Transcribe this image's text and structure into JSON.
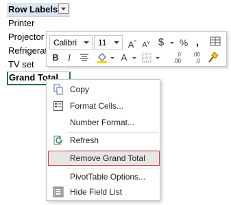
{
  "sheet": {
    "header": "Row Labels",
    "rows": [
      "Printer",
      "Projector",
      "Refrigerator",
      "TV set"
    ],
    "grand_total": "Grand Total"
  },
  "minibar": {
    "font_name": "Calibri",
    "font_size": "11",
    "grow_label": "A",
    "shrink_label": "A",
    "currency_label": "$",
    "percent_label": "%",
    "comma_label": " , ",
    "bold_label": "B",
    "italic_label": "I",
    "font_color_label": "A",
    "increase_decimal_label": "←.0 .00",
    "decrease_decimal_label": ".00 →.0"
  },
  "menu": {
    "items": [
      {
        "label": "Copy"
      },
      {
        "label": "Format Cells..."
      },
      {
        "label": "Number Format..."
      },
      {
        "label": "Refresh"
      },
      {
        "label": "Remove Grand Total"
      },
      {
        "label": "PivotTable Options..."
      },
      {
        "label": "Hide Field List"
      }
    ]
  },
  "colors": {
    "accent": "#217346",
    "header_fill": "#dce6f1",
    "highlight_border": "#c0504d"
  }
}
